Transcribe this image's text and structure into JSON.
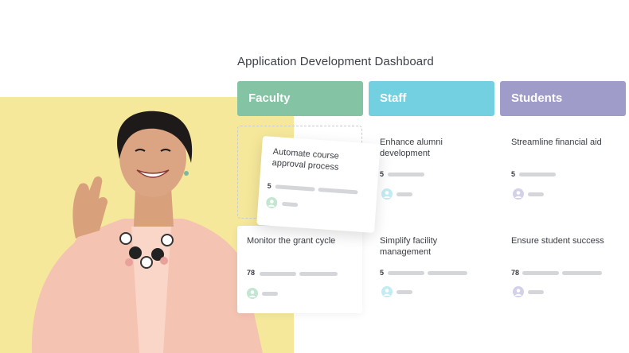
{
  "dashboard": {
    "title": "Application Development Dashboard"
  },
  "columns": [
    {
      "label": "Faculty",
      "color": "#84c4a4"
    },
    {
      "label": "Staff",
      "color": "#72d0e1"
    },
    {
      "label": "Students",
      "color": "#9f9cca"
    }
  ],
  "cards": {
    "dragged": {
      "title": "Automate course approval process",
      "count": "5"
    },
    "faculty_1": {
      "title": "Monitor the grant cycle",
      "count": "78"
    },
    "staff_0": {
      "title": "Enhance alumni development",
      "count": "5"
    },
    "staff_1": {
      "title": "Simplify facility management",
      "count": "5"
    },
    "students_0": {
      "title": "Streamline financial aid",
      "count": "5"
    },
    "students_1": {
      "title": "Ensure student success",
      "count": "78"
    }
  },
  "colors": {
    "background_accent": "#f6e89a",
    "avatar_faculty": "#c3e6d2",
    "avatar_staff": "#c2ecf3",
    "avatar_students": "#d3d1ea"
  }
}
